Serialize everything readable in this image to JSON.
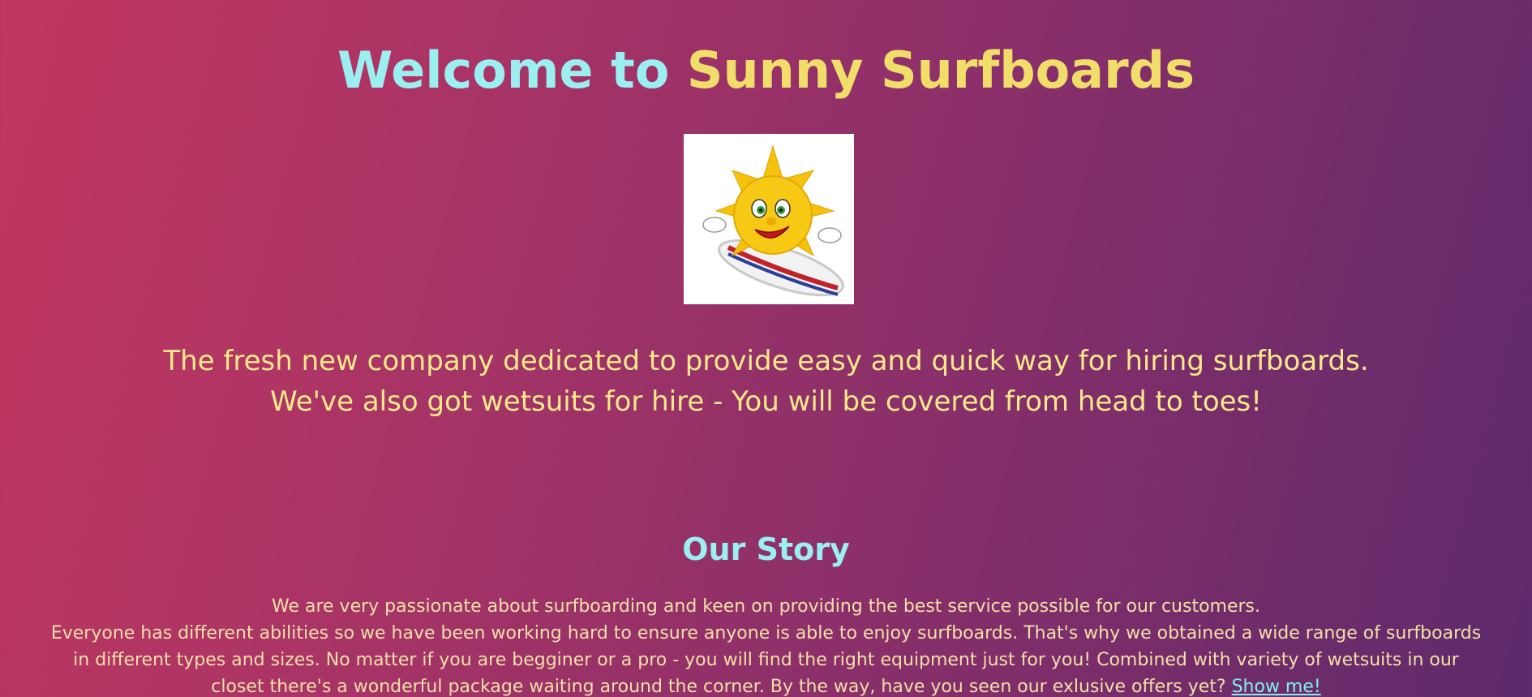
{
  "header": {
    "title_part1": "Welcome to",
    "title_part2": "Sunny Surfboards"
  },
  "logo": {
    "icon": "sun-surfing-icon"
  },
  "intro": {
    "line1": "The fresh new company dedicated to provide easy and quick way for hiring surfboards.",
    "line2": "We've also got wetsuits for hire - You will be covered from head to toes!"
  },
  "story": {
    "heading": "Our Story",
    "line1": "We are very passionate about surfboarding and keen on providing the best service possible for our customers.",
    "line2": "Everyone has different abilities so we have been working hard to ensure anyone is able to enjoy surfboards. That's why we obtained a wide range of surfboards",
    "line3": "in different types and sizes. No matter if you are begginer or a pro - you will find the right equipment just for you! Combined with variety of wetsuits in our",
    "line4": "closet there's a wonderful package waiting around the corner. By the way, have you seen our exlusive offers yet?",
    "link_text": "Show me!"
  },
  "colors": {
    "gradient_start": "#c2375f",
    "gradient_end": "#5d2a6b",
    "title_cyan": "#9beff0",
    "title_yellow": "#f1dd6a",
    "text_yellow": "#fbe98a",
    "link_cyan": "#7ff0f5"
  }
}
